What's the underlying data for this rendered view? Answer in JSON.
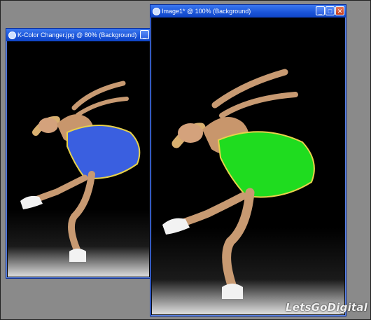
{
  "windows": {
    "back": {
      "title": "K-Color Changer.jpg @  80% (Background)",
      "dress_color": "#3a5fe0"
    },
    "front": {
      "title": "Image1* @ 100% (Background)",
      "dress_color": "#1fdc1f"
    }
  },
  "controls": {
    "minimize": "_",
    "maximize": "□",
    "close": "✕"
  },
  "watermark": "LetsGoDigital",
  "colors": {
    "desktop": "#8a8a8a",
    "titlebar": "#1a54d8",
    "trim": "#e8d24a"
  }
}
